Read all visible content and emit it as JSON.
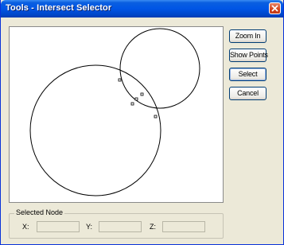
{
  "window": {
    "title": "Tools - Intersect Selector"
  },
  "buttons": {
    "zoom_in": "Zoom In",
    "show_points": "Show Points",
    "select": "Select",
    "cancel": "Cancel"
  },
  "selected_node": {
    "group_label": "Selected Node",
    "x_label": "X:",
    "y_label": "Y:",
    "z_label": "Z:",
    "x_value": "",
    "y_value": "",
    "z_value": ""
  },
  "colors": {
    "titlebar": "#0055e5",
    "close_button": "#d5421a",
    "window_background": "#ece9d8"
  }
}
